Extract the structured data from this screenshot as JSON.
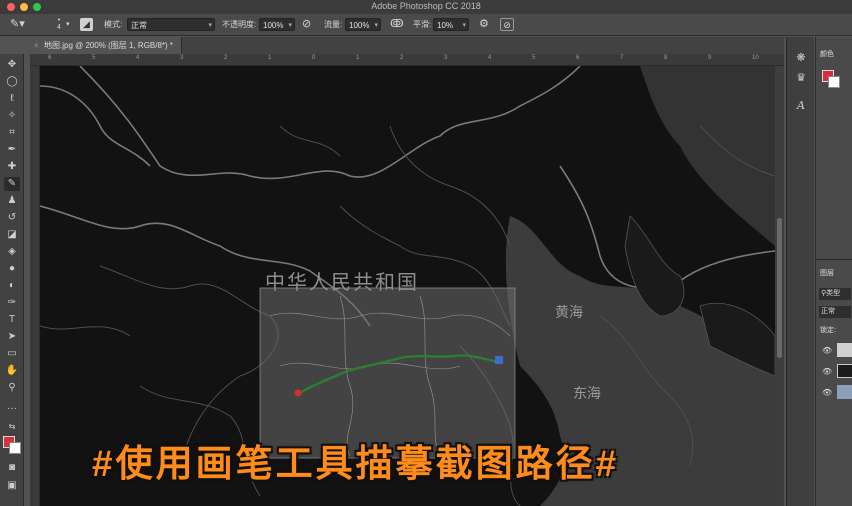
{
  "window": {
    "title": "Adobe Photoshop CC 2018"
  },
  "options_bar": {
    "mode_label": "模式:",
    "mode_value": "正常",
    "opacity_label": "不透明度:",
    "opacity_value": "100%",
    "flow_label": "流量:",
    "flow_value": "100%",
    "smoothing_label": "平滑:",
    "smoothing_value": "10%",
    "brush_size": "4"
  },
  "document_tab": {
    "close": "×",
    "label": "地图.jpg @ 200% (图层 1, RGB/8*) *"
  },
  "ruler_labels": [
    "6",
    "5",
    "4",
    "3",
    "2",
    "1",
    "0",
    "1",
    "2",
    "3",
    "4",
    "5",
    "6",
    "7",
    "8",
    "9",
    "10"
  ],
  "map": {
    "country_label": "中华人民共和国",
    "sea_yellow": "黄海",
    "sea_east": "东海"
  },
  "caption": "#使用画笔工具描摹截图路径#",
  "right_panel": {
    "color_tab": "颜色",
    "layers_tab": "图层",
    "kind_filter": "类型",
    "blend_mode": "正常",
    "lock_label": "锁定:"
  },
  "colors": {
    "foreground": "#d8303a",
    "background": "#ffffff",
    "caption": "#ff8c1a",
    "route": "#2e7d32"
  },
  "tools": [
    "move-icon",
    "marquee-icon",
    "lasso-icon",
    "magic-wand-icon",
    "crop-icon",
    "eyedropper-icon",
    "healing-icon",
    "brush-icon",
    "stamp-icon",
    "history-brush-icon",
    "eraser-icon",
    "bucket-icon",
    "blur-icon",
    "dodge-icon",
    "pen-icon",
    "type-icon",
    "path-select-icon",
    "rectangle-icon",
    "hand-icon",
    "zoom-icon",
    "more-icon"
  ]
}
